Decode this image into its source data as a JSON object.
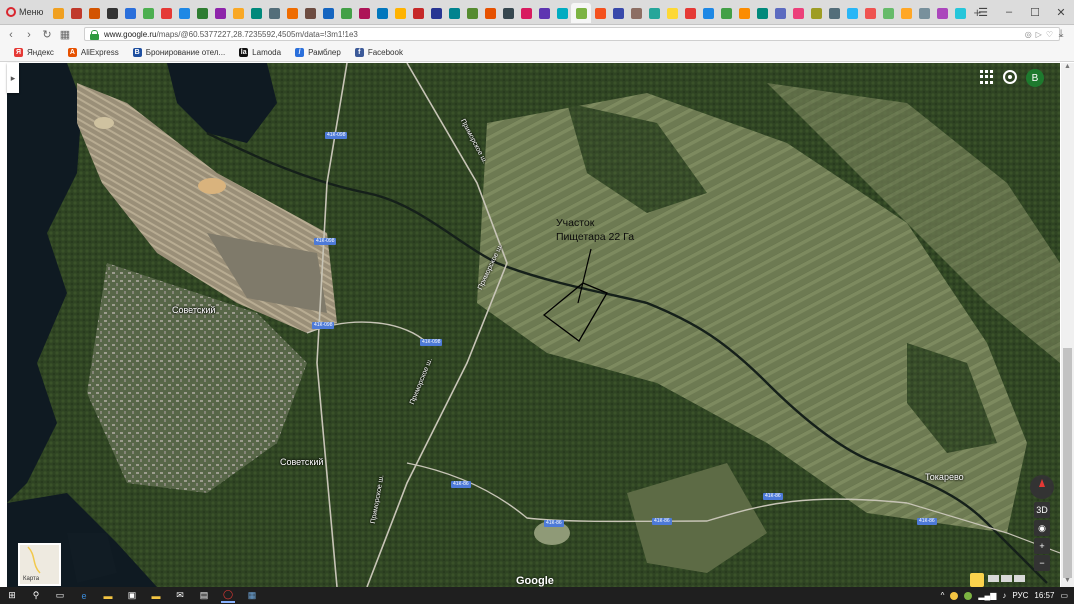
{
  "browser": {
    "menu_label": "Меню",
    "tab_colors": [
      "#f0a020",
      "#c0392b",
      "#d35400",
      "#333333",
      "#2a6fdb",
      "#4caf50",
      "#e53935",
      "#1e88e5",
      "#2e7d32",
      "#8e24aa",
      "#f9a825",
      "#00897b",
      "#546e7a",
      "#ef6c00",
      "#6d4c41",
      "#1565c0",
      "#43a047",
      "#ad1457",
      "#0277bd",
      "#ffb300",
      "#c62828",
      "#283593",
      "#00838f",
      "#558b2f",
      "#e65100",
      "#37474f",
      "#d81b60",
      "#5e35b1",
      "#00acc1",
      "#7cb342",
      "#f4511e",
      "#3949ab",
      "#8d6e63",
      "#26a69a",
      "#fdd835",
      "#e53935",
      "#1e88e5",
      "#43a047",
      "#fb8c00",
      "#00897b",
      "#5c6bc0",
      "#ec407a",
      "#9e9d24",
      "#546e7a",
      "#29b6f6",
      "#ef5350",
      "#66bb6a",
      "#ffa726",
      "#78909c",
      "#ab47bc",
      "#26c6da"
    ],
    "active_tab_index": 29,
    "new_tab_label": "+",
    "window_controls": {
      "tabs_menu": "☰",
      "minimize": "–",
      "maximize": "☐",
      "close": "✕"
    },
    "url_host": "www.google.ru",
    "url_path": "/maps/@60.5377227,28.7235592,4505m/data=!3m1!1e3",
    "bookmarks": [
      {
        "label": "Яндекс",
        "icon": "yandex-icon",
        "color": "#e53935",
        "glyph": "Я"
      },
      {
        "label": "AliExpress",
        "icon": "aliexpress-icon",
        "color": "#e65100",
        "glyph": "A"
      },
      {
        "label": "Бронирование отел...",
        "icon": "booking-icon",
        "color": "#1e4fa0",
        "glyph": "B"
      },
      {
        "label": "Lamoda",
        "icon": "lamoda-icon",
        "color": "#111111",
        "glyph": "la"
      },
      {
        "label": "Рамблер",
        "icon": "rambler-icon",
        "color": "#2a6fdb",
        "glyph": "/"
      },
      {
        "label": "Facebook",
        "icon": "facebook-icon",
        "color": "#3b5998",
        "glyph": "f"
      }
    ]
  },
  "map": {
    "avatar_letter": "В",
    "places": {
      "sovetsky_1": "Советский",
      "sovetsky_2": "Советский",
      "tokarevo": "Токарево",
      "primorskoe_1": "Приморское ш.",
      "primorskoe_2": "Приморское ш.",
      "primorskoe_3": "Приморское ш.",
      "primorskoe_4": "Приморское ш."
    },
    "plot_label_line1": "Участок",
    "plot_label_line2": "Пищетара 22 Га",
    "road_tags": [
      "41К-098",
      "41К-098",
      "41К-098",
      "41К-098",
      "41К-86",
      "41К-86",
      "41К-86",
      "41К-86",
      "41К-86"
    ],
    "controls": {
      "three_d": "3D",
      "zoom_in": "+",
      "zoom_out": "−"
    },
    "google_logo": "Google",
    "minimap_caption": "Карта"
  },
  "taskbar": {
    "lang": "РУС",
    "time": "16:57"
  }
}
